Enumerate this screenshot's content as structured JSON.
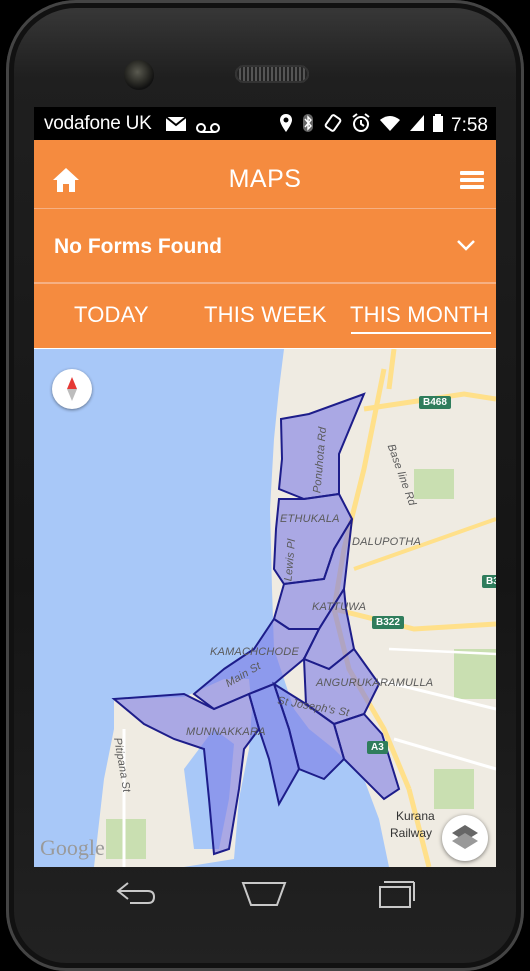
{
  "status": {
    "carrier": "vodafone UK",
    "time": "7:58",
    "icons": [
      "mail-icon",
      "voicemail-icon",
      "location-icon",
      "bluetooth-icon",
      "rotate-icon",
      "alarm-icon",
      "wifi-icon",
      "signal-icon",
      "battery-icon"
    ]
  },
  "appbar": {
    "title": "MAPS",
    "home_icon": "home-icon",
    "menu_icon": "menu-icon"
  },
  "forms": {
    "selected": "No Forms Found",
    "chevron_icon": "chevron-down-icon"
  },
  "tabs": [
    {
      "label": "TODAY",
      "active": false
    },
    {
      "label": "THIS WEEK",
      "active": false
    },
    {
      "label": "THIS MONTH",
      "active": true
    }
  ],
  "map": {
    "road_labels": [
      "Ponuhota Rd",
      "Base line Rd",
      "Lewis Pl",
      "Main St",
      "St Joseph's St",
      "Pitipana St"
    ],
    "area_labels": [
      "ETHUKALA",
      "DALUPOTHA",
      "KATTUWA",
      "KAMACHCHODE",
      "ANGURUKARAMULLA",
      "MUNNAKKARA"
    ],
    "shields": [
      "B468",
      "B322",
      "A3",
      "B3"
    ],
    "places": [
      "Kurana",
      "Railway"
    ],
    "attribution": "Google",
    "compass_icon": "compass-icon",
    "layers_icon": "layers-icon"
  },
  "navbar": {
    "back_icon": "back-icon",
    "home_icon": "home-outline-icon",
    "recents_icon": "recents-icon"
  },
  "colors": {
    "accent": "#f58b3f",
    "water": "#a8c8f8",
    "polygon_fill": "#7c7ce6",
    "polygon_stroke": "#1d1d8a"
  }
}
